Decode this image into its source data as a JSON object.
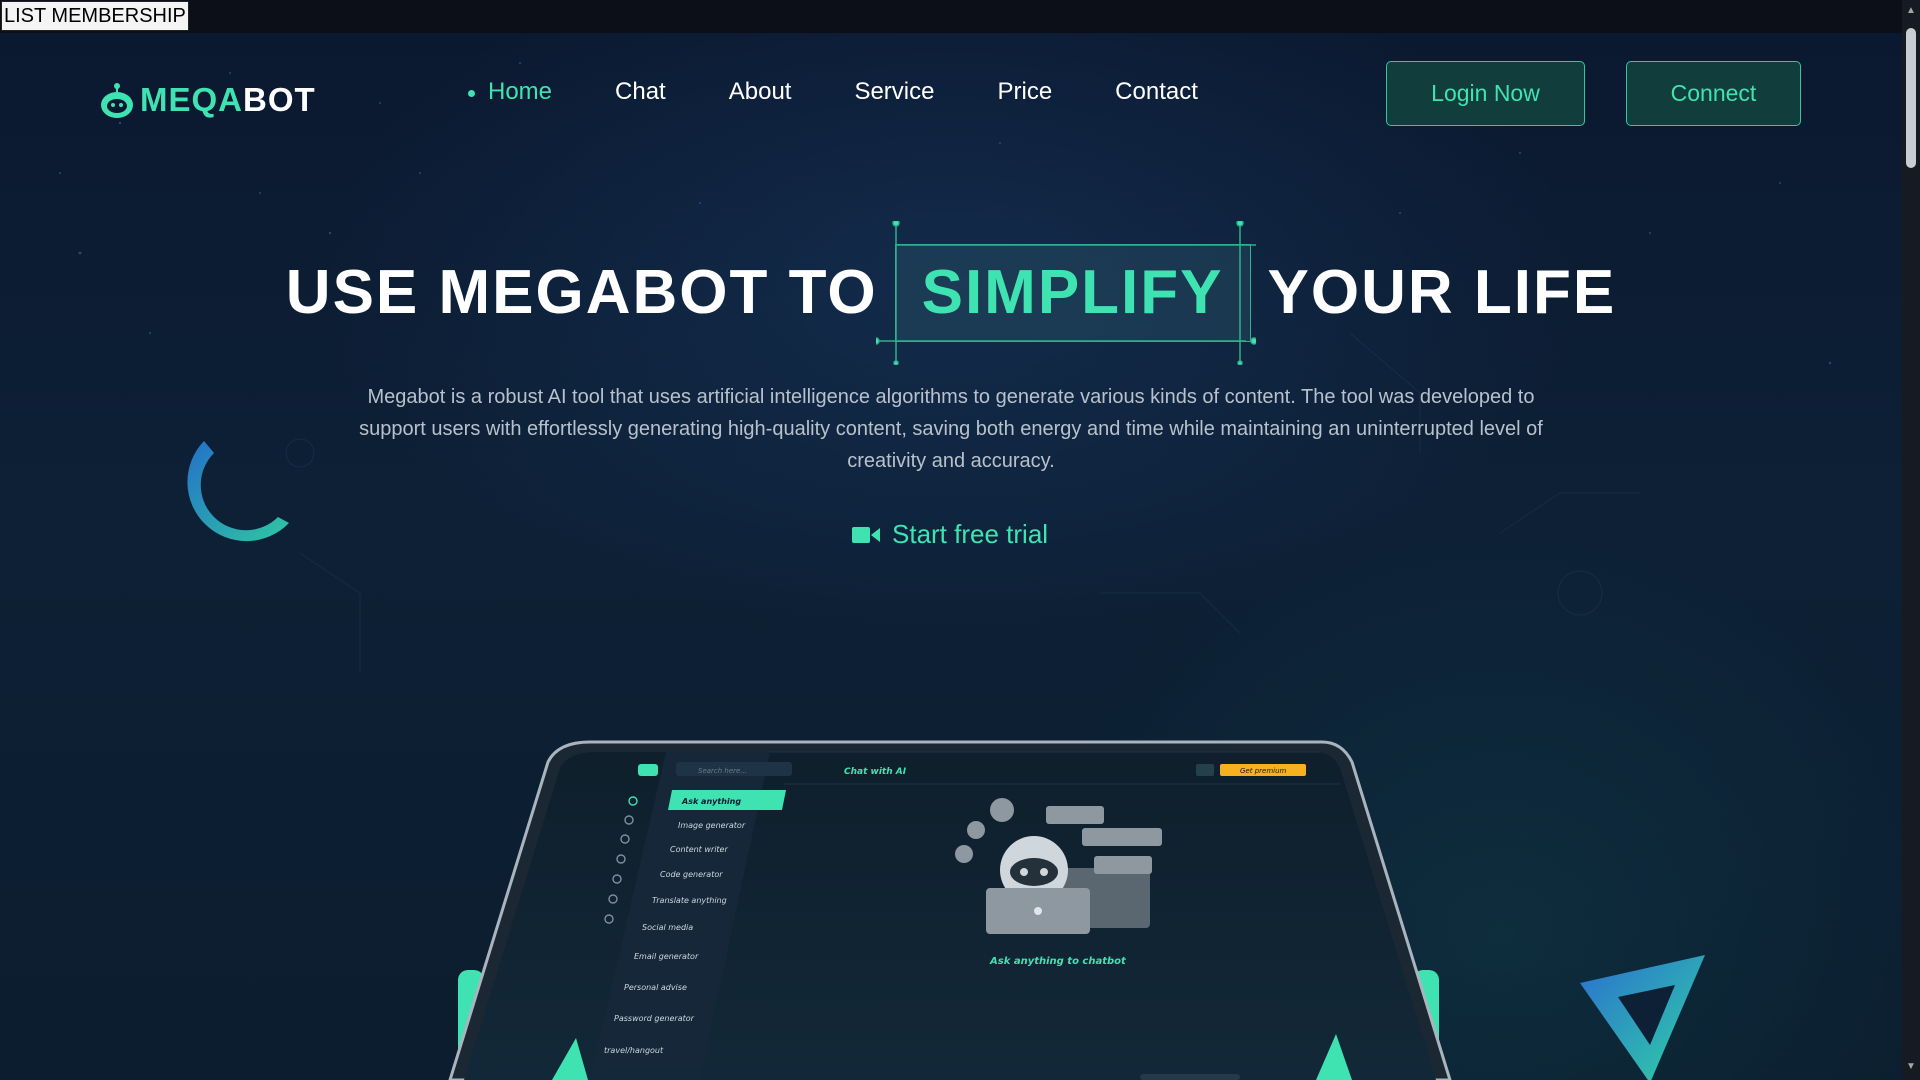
{
  "topbar": {
    "list_membership": "LIST MEMBERSHIP"
  },
  "logo": {
    "part_a": "MEQA",
    "part_b": "BOT"
  },
  "nav": {
    "items": [
      "Home",
      "Chat",
      "About",
      "Service",
      "Price",
      "Contact"
    ]
  },
  "header_buttons": {
    "login": "Login Now",
    "connect": "Connect"
  },
  "hero": {
    "title_before": "USE MEGABOT TO",
    "title_highlight": "SIMPLIFY",
    "title_after": "YOUR LIFE",
    "description": "Megabot is a robust AI tool that uses artificial intelligence algorithms to generate various kinds of content. The tool was developed to support users with effortlessly generating high-quality content, saving both energy and time while maintaining an uninterrupted level of creativity and accuracy.",
    "cta_label": "Start free trial",
    "cta_icon": "video-camera-icon"
  },
  "mockup": {
    "search_placeholder": "Search here...",
    "header_title": "Chat with AI",
    "premium_label": "Get premium",
    "menu_items": [
      "Ask anything",
      "Image generator",
      "Content writer",
      "Code generator",
      "Translate anything",
      "Social media",
      "Email generator",
      "Personal advise",
      "Password generator",
      "travel/hangout"
    ],
    "empty_caption": "Ask anything to chatbot"
  },
  "colors": {
    "accent": "#3fe3b1",
    "background": "#0b1930",
    "button_bg": "#123d3d",
    "premium": "#f5b120"
  }
}
